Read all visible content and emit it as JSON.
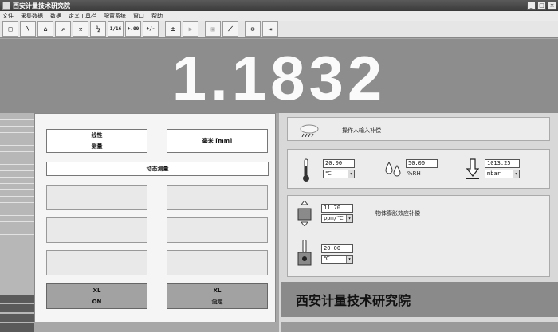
{
  "window": {
    "title": "西安计量技术研究院"
  },
  "menu": [
    "文件",
    "采集数据",
    "数据",
    "定义工具栏",
    "配置系统",
    "窗口",
    "帮助"
  ],
  "toolbar": [
    {
      "icon": "new-file-icon",
      "glyph": "□"
    },
    {
      "icon": "probe-icon",
      "glyph": "\\"
    },
    {
      "icon": "open-folder-icon",
      "glyph": "⌂"
    },
    {
      "icon": "measure-icon",
      "glyph": "↗"
    },
    {
      "icon": "tool-icon",
      "glyph": "⚒"
    },
    {
      "icon": "one-half-icon",
      "glyph": "½"
    },
    {
      "icon": "one-sixteenth-icon",
      "glyph": "1/16"
    },
    {
      "icon": "decimal-icon",
      "glyph": "+.00"
    },
    {
      "icon": "plus-minus-icon",
      "glyph": "+/-"
    },
    {
      "icon": "sign-toggle-icon",
      "glyph": "±"
    },
    {
      "icon": "play-icon",
      "glyph": "▶"
    },
    {
      "icon": "calibrate-icon",
      "glyph": "▣"
    },
    {
      "icon": "graph-icon",
      "glyph": "⟋"
    },
    {
      "icon": "settings-icon",
      "glyph": "⚙"
    },
    {
      "icon": "exit-icon",
      "glyph": "⇥"
    }
  ],
  "reading": "1.1832",
  "left": {
    "linearity_line1": "线性",
    "linearity_line2": "测量",
    "unit": "毫米 [mm]",
    "dynamic": "动态测量",
    "xl_on_line1": "XL",
    "xl_on_line2": "ON",
    "xl_set_line1": "XL",
    "xl_set_line2": "设定"
  },
  "env": {
    "operator_label": "操作人输入补偿",
    "temperature_value": "20.00",
    "temperature_unit": "℃",
    "humidity_value": "50.00",
    "humidity_unit": "%RH",
    "pressure_value": "1013.25",
    "pressure_unit": "mbar"
  },
  "material": {
    "label": "物体膨胀效应补偿",
    "coefficient_value": "11.70",
    "coefficient_unit": "ppm/℃",
    "temperature_value": "20.00",
    "temperature_unit": "℃"
  },
  "brand": "西安计量技术研究院"
}
